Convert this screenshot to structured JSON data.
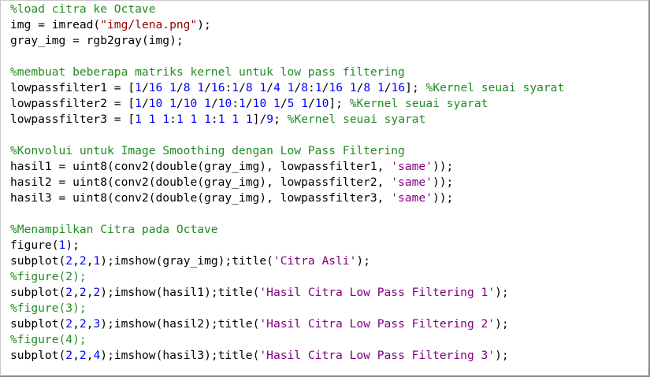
{
  "editor": {
    "language": "Octave",
    "lines": [
      [
        {
          "t": "c",
          "v": "%load citra ke Octave"
        }
      ],
      [
        {
          "t": "p",
          "v": "img = imread("
        },
        {
          "t": "d",
          "v": "\"img/lena.png\""
        },
        {
          "t": "p",
          "v": ");"
        }
      ],
      [
        {
          "t": "p",
          "v": "gray_img = rgb2gray(img);"
        }
      ],
      [
        {
          "t": "p",
          "v": ""
        }
      ],
      [
        {
          "t": "c",
          "v": "%membuat beberapa matriks kernel untuk low pass filtering"
        }
      ],
      [
        {
          "t": "p",
          "v": "lowpassfilter1 = ["
        },
        {
          "t": "n",
          "v": "1"
        },
        {
          "t": "p",
          "v": "/"
        },
        {
          "t": "n",
          "v": "16"
        },
        {
          "t": "p",
          "v": " "
        },
        {
          "t": "n",
          "v": "1"
        },
        {
          "t": "p",
          "v": "/"
        },
        {
          "t": "n",
          "v": "8"
        },
        {
          "t": "p",
          "v": " "
        },
        {
          "t": "n",
          "v": "1"
        },
        {
          "t": "p",
          "v": "/"
        },
        {
          "t": "n",
          "v": "16"
        },
        {
          "t": "p",
          "v": ":"
        },
        {
          "t": "n",
          "v": "1"
        },
        {
          "t": "p",
          "v": "/"
        },
        {
          "t": "n",
          "v": "8"
        },
        {
          "t": "p",
          "v": " "
        },
        {
          "t": "n",
          "v": "1"
        },
        {
          "t": "p",
          "v": "/"
        },
        {
          "t": "n",
          "v": "4"
        },
        {
          "t": "p",
          "v": " "
        },
        {
          "t": "n",
          "v": "1"
        },
        {
          "t": "p",
          "v": "/"
        },
        {
          "t": "n",
          "v": "8"
        },
        {
          "t": "p",
          "v": ":"
        },
        {
          "t": "n",
          "v": "1"
        },
        {
          "t": "p",
          "v": "/"
        },
        {
          "t": "n",
          "v": "16"
        },
        {
          "t": "p",
          "v": " "
        },
        {
          "t": "n",
          "v": "1"
        },
        {
          "t": "p",
          "v": "/"
        },
        {
          "t": "n",
          "v": "8"
        },
        {
          "t": "p",
          "v": " "
        },
        {
          "t": "n",
          "v": "1"
        },
        {
          "t": "p",
          "v": "/"
        },
        {
          "t": "n",
          "v": "16"
        },
        {
          "t": "p",
          "v": "]; "
        },
        {
          "t": "c",
          "v": "%Kernel seuai syarat"
        }
      ],
      [
        {
          "t": "p",
          "v": "lowpassfilter2 = ["
        },
        {
          "t": "n",
          "v": "1"
        },
        {
          "t": "p",
          "v": "/"
        },
        {
          "t": "n",
          "v": "10"
        },
        {
          "t": "p",
          "v": " "
        },
        {
          "t": "n",
          "v": "1"
        },
        {
          "t": "p",
          "v": "/"
        },
        {
          "t": "n",
          "v": "10"
        },
        {
          "t": "p",
          "v": " "
        },
        {
          "t": "n",
          "v": "1"
        },
        {
          "t": "p",
          "v": "/"
        },
        {
          "t": "n",
          "v": "10"
        },
        {
          "t": "p",
          "v": ":"
        },
        {
          "t": "n",
          "v": "1"
        },
        {
          "t": "p",
          "v": "/"
        },
        {
          "t": "n",
          "v": "10"
        },
        {
          "t": "p",
          "v": " "
        },
        {
          "t": "n",
          "v": "1"
        },
        {
          "t": "p",
          "v": "/"
        },
        {
          "t": "n",
          "v": "5"
        },
        {
          "t": "p",
          "v": " "
        },
        {
          "t": "n",
          "v": "1"
        },
        {
          "t": "p",
          "v": "/"
        },
        {
          "t": "n",
          "v": "10"
        },
        {
          "t": "p",
          "v": "]; "
        },
        {
          "t": "c",
          "v": "%Kernel seuai syarat"
        }
      ],
      [
        {
          "t": "p",
          "v": "lowpassfilter3 = ["
        },
        {
          "t": "n",
          "v": "1"
        },
        {
          "t": "p",
          "v": " "
        },
        {
          "t": "n",
          "v": "1"
        },
        {
          "t": "p",
          "v": " "
        },
        {
          "t": "n",
          "v": "1"
        },
        {
          "t": "p",
          "v": ":"
        },
        {
          "t": "n",
          "v": "1"
        },
        {
          "t": "p",
          "v": " "
        },
        {
          "t": "n",
          "v": "1"
        },
        {
          "t": "p",
          "v": " "
        },
        {
          "t": "n",
          "v": "1"
        },
        {
          "t": "p",
          "v": ":"
        },
        {
          "t": "n",
          "v": "1"
        },
        {
          "t": "p",
          "v": " "
        },
        {
          "t": "n",
          "v": "1"
        },
        {
          "t": "p",
          "v": " "
        },
        {
          "t": "n",
          "v": "1"
        },
        {
          "t": "p",
          "v": "]/"
        },
        {
          "t": "n",
          "v": "9"
        },
        {
          "t": "p",
          "v": "; "
        },
        {
          "t": "c",
          "v": "%Kernel seuai syarat"
        }
      ],
      [
        {
          "t": "p",
          "v": ""
        }
      ],
      [
        {
          "t": "c",
          "v": "%Konvolui untuk Image Smoothing dengan Low Pass Filtering"
        }
      ],
      [
        {
          "t": "p",
          "v": "hasil1 = uint8(conv2(double(gray_img), lowpassfilter1, "
        },
        {
          "t": "s",
          "v": "'same'"
        },
        {
          "t": "p",
          "v": "));"
        }
      ],
      [
        {
          "t": "p",
          "v": "hasil2 = uint8(conv2(double(gray_img), lowpassfilter2, "
        },
        {
          "t": "s",
          "v": "'same'"
        },
        {
          "t": "p",
          "v": "));"
        }
      ],
      [
        {
          "t": "p",
          "v": "hasil3 = uint8(conv2(double(gray_img), lowpassfilter3, "
        },
        {
          "t": "s",
          "v": "'same'"
        },
        {
          "t": "p",
          "v": "));"
        }
      ],
      [
        {
          "t": "p",
          "v": ""
        }
      ],
      [
        {
          "t": "c",
          "v": "%Menampilkan Citra pada Octave"
        }
      ],
      [
        {
          "t": "p",
          "v": "figure("
        },
        {
          "t": "n",
          "v": "1"
        },
        {
          "t": "p",
          "v": ");"
        }
      ],
      [
        {
          "t": "p",
          "v": "subplot("
        },
        {
          "t": "n",
          "v": "2"
        },
        {
          "t": "p",
          "v": ","
        },
        {
          "t": "n",
          "v": "2"
        },
        {
          "t": "p",
          "v": ","
        },
        {
          "t": "n",
          "v": "1"
        },
        {
          "t": "p",
          "v": ");imshow(gray_img);title("
        },
        {
          "t": "s",
          "v": "'Citra Asli'"
        },
        {
          "t": "p",
          "v": ");"
        }
      ],
      [
        {
          "t": "c",
          "v": "%figure(2);"
        }
      ],
      [
        {
          "t": "p",
          "v": "subplot("
        },
        {
          "t": "n",
          "v": "2"
        },
        {
          "t": "p",
          "v": ","
        },
        {
          "t": "n",
          "v": "2"
        },
        {
          "t": "p",
          "v": ","
        },
        {
          "t": "n",
          "v": "2"
        },
        {
          "t": "p",
          "v": ");imshow(hasil1);title("
        },
        {
          "t": "s",
          "v": "'Hasil Citra Low Pass Filtering 1'"
        },
        {
          "t": "p",
          "v": ");"
        }
      ],
      [
        {
          "t": "c",
          "v": "%figure(3);"
        }
      ],
      [
        {
          "t": "p",
          "v": "subplot("
        },
        {
          "t": "n",
          "v": "2"
        },
        {
          "t": "p",
          "v": ","
        },
        {
          "t": "n",
          "v": "2"
        },
        {
          "t": "p",
          "v": ","
        },
        {
          "t": "n",
          "v": "3"
        },
        {
          "t": "p",
          "v": ");imshow(hasil2);title("
        },
        {
          "t": "s",
          "v": "'Hasil Citra Low Pass Filtering 2'"
        },
        {
          "t": "p",
          "v": ");"
        }
      ],
      [
        {
          "t": "c",
          "v": "%figure(4);"
        }
      ],
      [
        {
          "t": "p",
          "v": "subplot("
        },
        {
          "t": "n",
          "v": "2"
        },
        {
          "t": "p",
          "v": ","
        },
        {
          "t": "n",
          "v": "2"
        },
        {
          "t": "p",
          "v": ","
        },
        {
          "t": "n",
          "v": "4"
        },
        {
          "t": "p",
          "v": ");imshow(hasil3);title("
        },
        {
          "t": "s",
          "v": "'Hasil Citra Low Pass Filtering 3'"
        },
        {
          "t": "p",
          "v": ");"
        }
      ]
    ]
  },
  "colors": {
    "comment": "#228b22",
    "number": "#0000ff",
    "string_single": "#800080",
    "string_double": "#8b0000",
    "plain": "#000000",
    "background": "#ffffff"
  }
}
